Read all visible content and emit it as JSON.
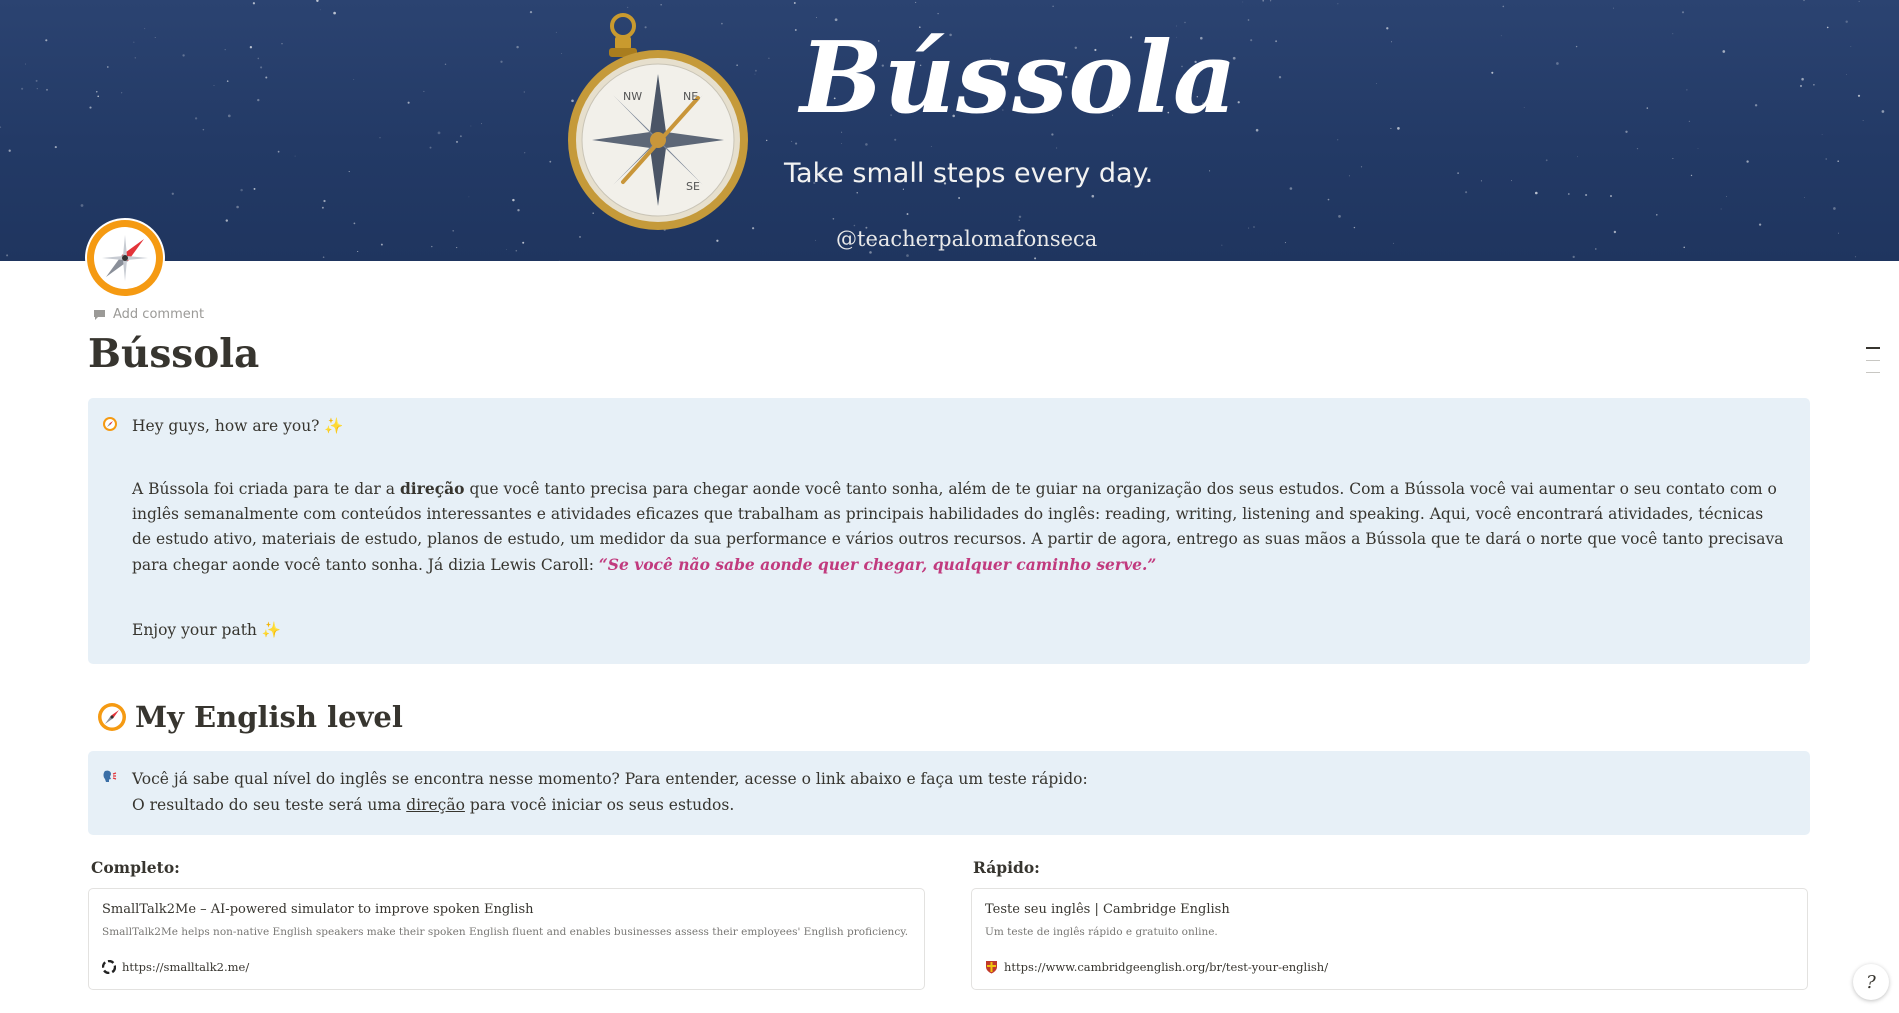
{
  "cover": {
    "title": "Bússola",
    "tagline": "Take small steps every day.",
    "handle": "@teacherpalomafonseca"
  },
  "page": {
    "add_comment": "Add comment",
    "title": "Bússola",
    "icon": "compass-icon"
  },
  "intro_callout": {
    "icon": "compass-icon",
    "greeting": "Hey guys, how are you? ✨",
    "para_pre": "A Bússola foi criada para te dar a ",
    "para_bold": "direção",
    "para_post": " que você tanto precisa para chegar aonde você tanto sonha, além de te guiar na organização dos seus estudos. Com a Bússola você vai aumentar o seu contato com o inglês semanalmente com conteúdos interessantes e atividades eficazes que trabalham as principais habilidades do inglês: reading, writing, listening and speaking. Aqui, você encontrará atividades, técnicas de estudo ativo, materiais de estudo, planos de estudo, um medidor da sua performance e vários outros recursos. A partir de agora, entrego as suas mãos a Bússola que te dará o norte que você tanto precisava para chegar aonde você tanto sonha. Já dizia Lewis Caroll: ",
    "quote": "“Se você não sabe aonde quer chegar, qualquer caminho serve.”",
    "closing": "Enjoy your path ✨"
  },
  "level_section": {
    "heading": "My English level",
    "callout_icon": "speaking-head-icon",
    "line1": "Você já sabe qual nível do inglês se encontra nesse momento? Para entender, acesse o link abaixo e faça um teste rápido:",
    "line2_pre": "O resultado do seu teste será uma ",
    "line2_underlined": "direção",
    "line2_post": " para você iniciar os seus estudos."
  },
  "columns": [
    {
      "label": "Completo:",
      "bookmark": {
        "title": "SmallTalk2Me – AI-powered simulator to improve spoken English",
        "description": "SmallTalk2Me helps non-native English speakers make their spoken English fluent and enables businesses assess their employees' English proficiency.",
        "url": "https://smalltalk2.me/",
        "favicon": "smalltalk-favicon"
      }
    },
    {
      "label": "Rápido:",
      "bookmark": {
        "title": "Teste seu inglês | Cambridge English",
        "description": "Um teste de inglês rápido e gratuito online.",
        "url": "https://www.cambridgeenglish.org/br/test-your-english/",
        "favicon": "cambridge-shield-favicon"
      }
    }
  ],
  "help_button": "?",
  "colors": {
    "cover_bg": "#233a66",
    "callout_bg": "#e7f0f7",
    "quote": "#c13a7e",
    "icon_orange": "#f59a12"
  }
}
